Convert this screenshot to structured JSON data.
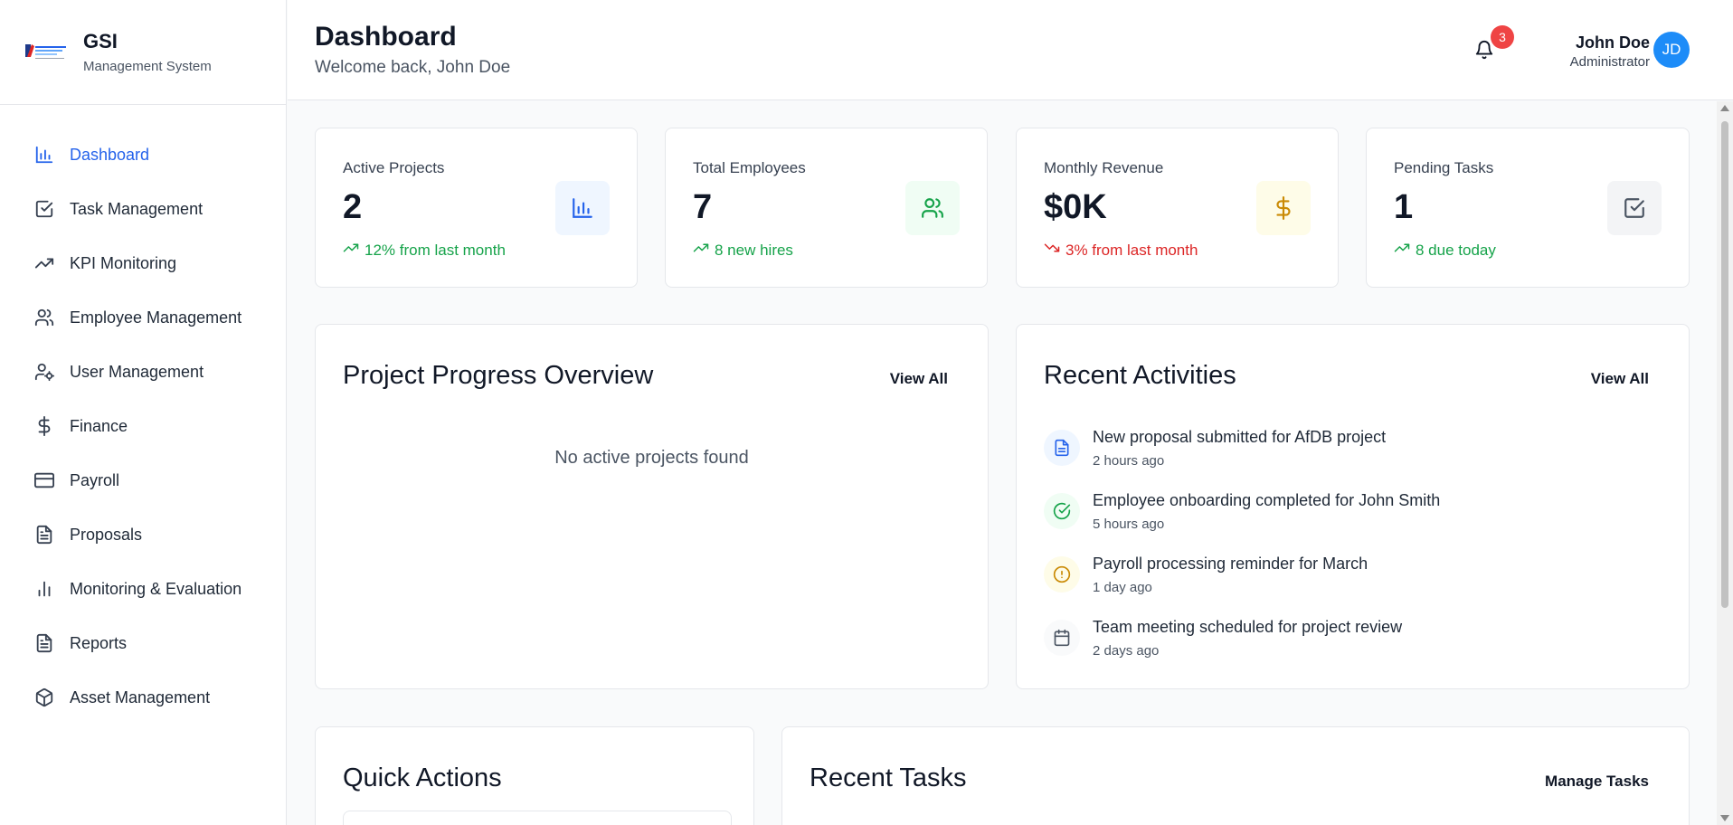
{
  "brand": {
    "name": "GSI",
    "subtitle": "Management System"
  },
  "sidebar": {
    "items": [
      {
        "label": "Dashboard",
        "icon": "bar-chart-icon",
        "active": true
      },
      {
        "label": "Task Management",
        "icon": "check-square-icon"
      },
      {
        "label": "KPI Monitoring",
        "icon": "trending-up-icon"
      },
      {
        "label": "Employee Management",
        "icon": "users-icon"
      },
      {
        "label": "User Management",
        "icon": "user-cog-icon"
      },
      {
        "label": "Finance",
        "icon": "dollar-icon"
      },
      {
        "label": "Payroll",
        "icon": "credit-card-icon"
      },
      {
        "label": "Proposals",
        "icon": "document-icon"
      },
      {
        "label": "Monitoring & Evaluation",
        "icon": "bar-chart-icon"
      },
      {
        "label": "Reports",
        "icon": "document-icon"
      },
      {
        "label": "Asset Management",
        "icon": "box-icon"
      }
    ]
  },
  "header": {
    "title": "Dashboard",
    "welcome": "Welcome back, John Doe",
    "notifications": "3",
    "user_name": "John Doe",
    "user_role": "Administrator",
    "avatar_initials": "JD"
  },
  "stats": [
    {
      "label": "Active Projects",
      "value": "2",
      "trend": "12% from last month",
      "trend_dir": "up",
      "icon": "bar-chart-icon",
      "icon_bg": "#eff6ff",
      "icon_color": "#2563eb"
    },
    {
      "label": "Total Employees",
      "value": "7",
      "trend": "8 new hires",
      "trend_dir": "up",
      "icon": "users-icon",
      "icon_bg": "#f0fdf4",
      "icon_color": "#16a34a"
    },
    {
      "label": "Monthly Revenue",
      "value": "$0K",
      "trend": "3% from last month",
      "trend_dir": "down",
      "icon": "dollar-icon",
      "icon_bg": "#fefce8",
      "icon_color": "#ca8a04"
    },
    {
      "label": "Pending Tasks",
      "value": "1",
      "trend": "8 due today",
      "trend_dir": "up",
      "icon": "check-square-icon",
      "icon_bg": "#f3f4f6",
      "icon_color": "#4b5563"
    }
  ],
  "project_progress": {
    "title": "Project Progress Overview",
    "view_all": "View All",
    "empty": "No active projects found"
  },
  "recent_activities": {
    "title": "Recent Activities",
    "view_all": "View All",
    "items": [
      {
        "title": "New proposal submitted for AfDB project",
        "time": "2 hours ago",
        "icon": "document-icon",
        "bg": "#eff6ff",
        "color": "#2563eb"
      },
      {
        "title": "Employee onboarding completed for John Smith",
        "time": "5 hours ago",
        "icon": "check-circle-icon",
        "bg": "#f0fdf4",
        "color": "#16a34a"
      },
      {
        "title": "Payroll processing reminder for March",
        "time": "1 day ago",
        "icon": "alert-circle-icon",
        "bg": "#fefce8",
        "color": "#ca8a04"
      },
      {
        "title": "Team meeting scheduled for project review",
        "time": "2 days ago",
        "icon": "calendar-icon",
        "bg": "#f9fafb",
        "color": "#4b5563"
      }
    ]
  },
  "quick_actions": {
    "title": "Quick Actions"
  },
  "recent_tasks": {
    "title": "Recent Tasks",
    "manage": "Manage Tasks"
  }
}
